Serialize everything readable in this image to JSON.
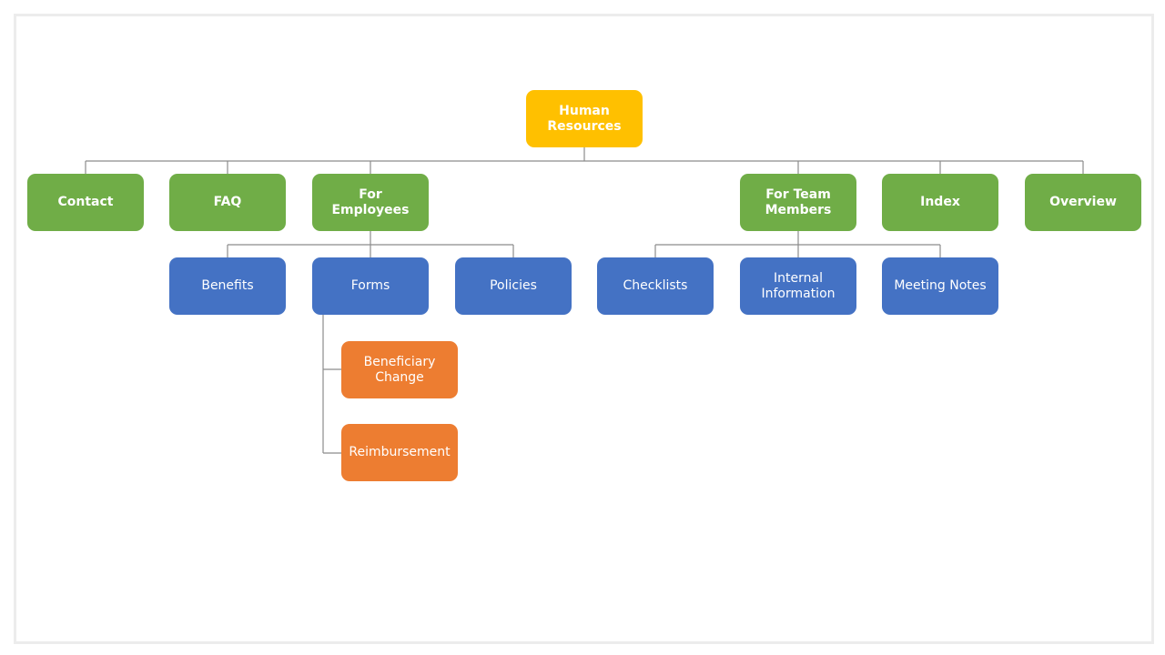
{
  "colors": {
    "root": "#ffc000",
    "level1": "#70ad47",
    "level2": "#4472c4",
    "level3": "#ed7d31",
    "connector": "#8c8c8c",
    "frame": "#ececec"
  },
  "diagram": {
    "root": {
      "label": "Human\nResources"
    },
    "level1": [
      {
        "label": "Contact"
      },
      {
        "label": "FAQ"
      },
      {
        "label": "For\nEmployees"
      },
      {
        "label": "For Team\nMembers"
      },
      {
        "label": "Index"
      },
      {
        "label": "Overview"
      }
    ],
    "employees_children": [
      {
        "label": "Benefits"
      },
      {
        "label": "Forms"
      },
      {
        "label": "Policies"
      }
    ],
    "team_children": [
      {
        "label": "Checklists"
      },
      {
        "label": "Internal\nInformation"
      },
      {
        "label": "Meeting Notes"
      }
    ],
    "forms_children": [
      {
        "label": "Beneficiary\nChange"
      },
      {
        "label": "Reimbursement"
      }
    ]
  }
}
